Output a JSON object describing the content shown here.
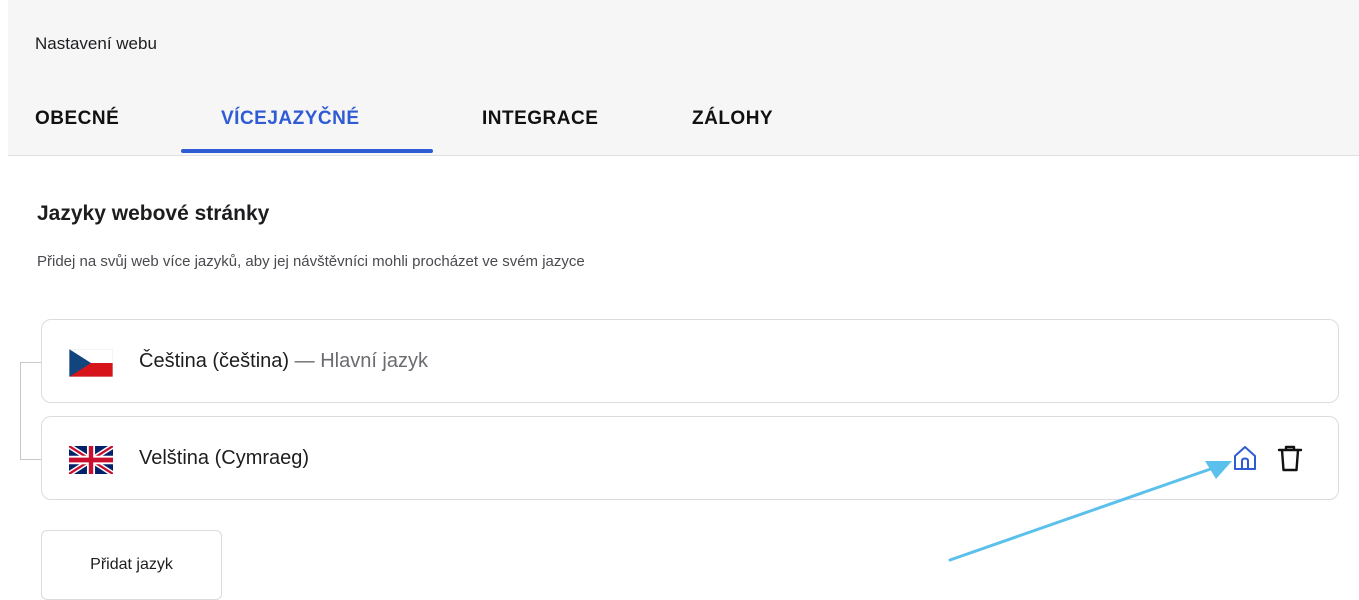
{
  "header": {
    "title": "Nastavení webu",
    "tabs": [
      {
        "label": "OBECNÉ",
        "active": false
      },
      {
        "label": "VÍCEJAZYČNÉ",
        "active": true
      },
      {
        "label": "INTEGRACE",
        "active": false
      },
      {
        "label": "ZÁLOHY",
        "active": false
      }
    ]
  },
  "section": {
    "title": "Jazyky webové stránky",
    "description": "Přidej na svůj web více jazyků, aby jej návštěvníci mohli procházet ve svém jazyce"
  },
  "languages": [
    {
      "name": "Čeština (čeština)",
      "separator": " — ",
      "main_label": "Hlavní jazyk",
      "flag": "czech-flag-icon"
    },
    {
      "name": "Velština (Cymraeg)",
      "flag": "uk-flag-icon",
      "actions": [
        "home-icon",
        "trash-icon"
      ]
    }
  ],
  "add_button": {
    "label": "Přidat jazyk"
  },
  "colors": {
    "accent": "#2f5bd3",
    "annotation_arrow": "#5bc0eb",
    "header_bg": "#f6f6f7"
  }
}
